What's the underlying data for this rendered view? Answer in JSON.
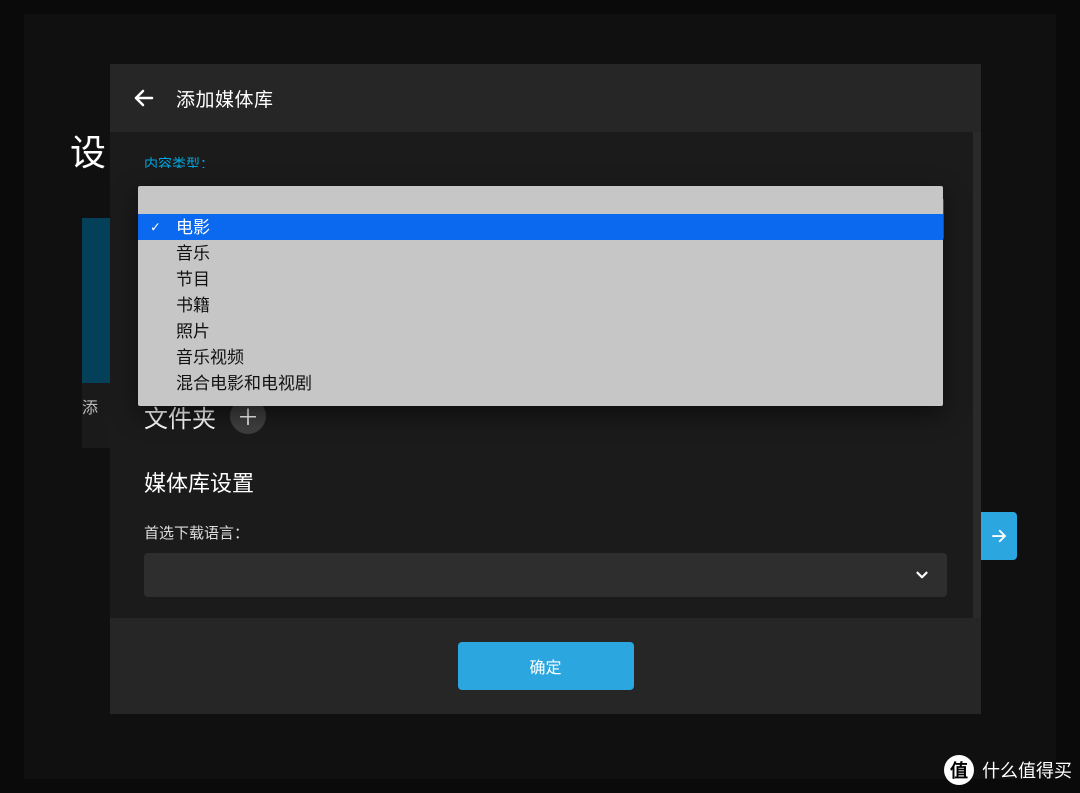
{
  "background": {
    "page_title_fragment": "设",
    "left_tile_caption_fragment": "添"
  },
  "modal": {
    "title": "添加媒体库",
    "content_type_label_fragment": "内容类型：",
    "dropdown": {
      "options": [
        {
          "label": "电影",
          "selected": true
        },
        {
          "label": "音乐",
          "selected": false
        },
        {
          "label": "节目",
          "selected": false
        },
        {
          "label": "书籍",
          "selected": false
        },
        {
          "label": "照片",
          "selected": false
        },
        {
          "label": "音乐视频",
          "selected": false
        },
        {
          "label": "混合电影和电视剧",
          "selected": false
        }
      ]
    },
    "folders_heading": "文件夹",
    "settings_heading": "媒体库设置",
    "download_lang_label": "首选下载语言：",
    "download_lang_value": "",
    "confirm_label": "确定"
  },
  "watermark": {
    "badge": "值",
    "text": "什么值得买"
  }
}
